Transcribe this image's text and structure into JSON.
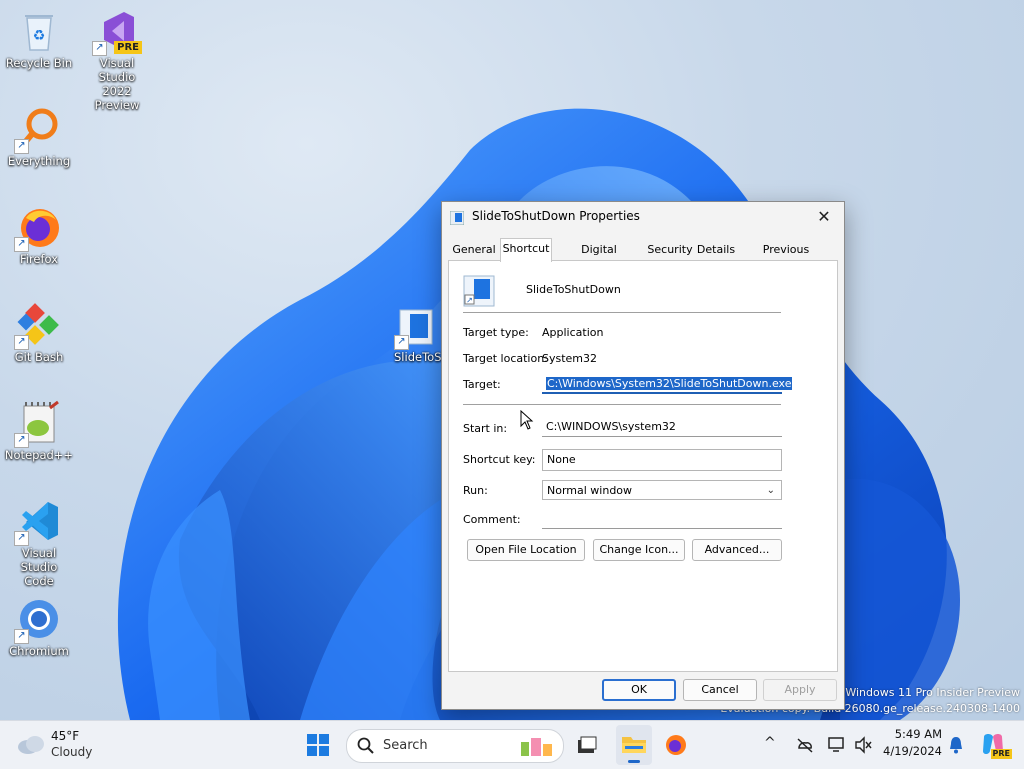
{
  "desktop_icons": [
    {
      "label": "Recycle Bin",
      "icon": "recycle-bin-icon"
    },
    {
      "label": "Visual Studio 2022 Preview",
      "line1": "Visual Studio",
      "line2": "2022 Preview",
      "badge": "PRE",
      "icon": "visual-studio-icon"
    },
    {
      "label": "Everything",
      "icon": "everything-search-icon"
    },
    {
      "label": "Firefox",
      "icon": "firefox-icon"
    },
    {
      "label": "Git Bash",
      "icon": "git-bash-icon"
    },
    {
      "label": "Notepad++",
      "icon": "notepadpp-icon"
    },
    {
      "label": "Visual Studio Code",
      "line1": "Visual Studio",
      "line2": "Code",
      "icon": "vscode-icon"
    },
    {
      "label": "Chromium",
      "icon": "chromium-icon"
    },
    {
      "label": "SlideToS",
      "icon": "slidetoshutdown-icon"
    }
  ],
  "dialog": {
    "title": "SlideToShutDown Properties",
    "close_glyph": "✕",
    "tabs": [
      "General",
      "Shortcut",
      "Digital Signatures",
      "Security",
      "Details",
      "Previous Versions"
    ],
    "active_tab": "Shortcut",
    "app_name": "SlideToShutDown",
    "target_type_label": "Target type:",
    "target_type_value": "Application",
    "target_location_label": "Target location:",
    "target_location_value": "System32",
    "target_label": "Target:",
    "target_value": "C:\\Windows\\System32\\SlideToShutDown.exe",
    "start_in_label": "Start in:",
    "start_in_value": "C:\\WINDOWS\\system32",
    "shortcut_key_label": "Shortcut key:",
    "shortcut_key_value": "None",
    "run_label": "Run:",
    "run_value": "Normal window",
    "comment_label": "Comment:",
    "comment_value": "",
    "open_file_location": "Open File Location",
    "change_icon": "Change Icon...",
    "advanced": "Advanced...",
    "ok": "OK",
    "cancel": "Cancel",
    "apply": "Apply"
  },
  "watermark": {
    "line1": "Windows 11 Pro Insider Preview",
    "line2": "Evaluation copy. Build 26080.ge_release.240308-1400"
  },
  "taskbar": {
    "weather_temp": "45°F",
    "weather_desc": "Cloudy",
    "search_label": "Search",
    "time": "5:49 AM",
    "date": "4/19/2024",
    "copilot_badge": "PRE"
  },
  "colors": {
    "accent": "#1e67c9",
    "wallpaper_bloom": "#1a6af0"
  }
}
